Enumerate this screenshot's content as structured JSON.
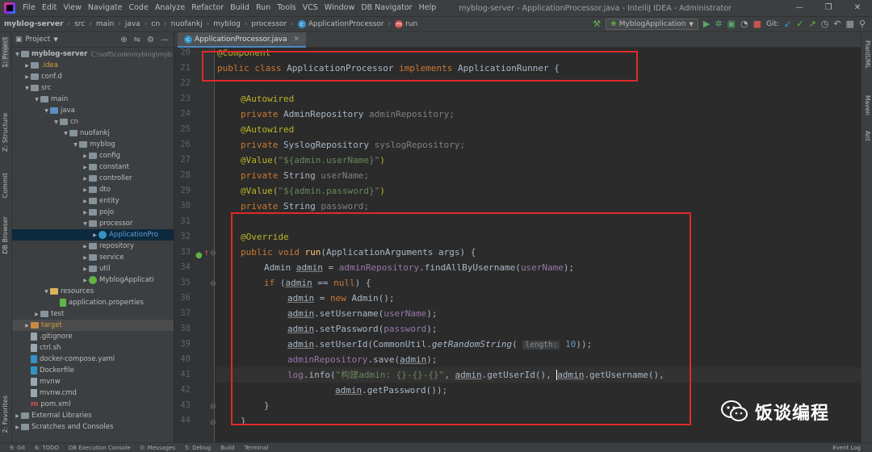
{
  "menubar": {
    "items": [
      "File",
      "Edit",
      "View",
      "Navigate",
      "Code",
      "Analyze",
      "Refactor",
      "Build",
      "Run",
      "Tools",
      "VCS",
      "Window",
      "DB Navigator",
      "Help"
    ],
    "window_title": "myblog-server - ApplicationProcessor.java - IntelliJ IDEA - Administrator",
    "minimize": "—",
    "maximize": "❐",
    "close": "✕"
  },
  "navbar": {
    "crumbs": [
      "myblog-server",
      "src",
      "main",
      "java",
      "cn",
      "nuofankj",
      "myblog",
      "processor",
      "ApplicationProcessor",
      "run"
    ],
    "run_config": "MyblogApplication",
    "git_label": "Git:"
  },
  "toolstrip_left": {
    "project": "1: Project",
    "structure": "Z: Structure",
    "commit": "Commit",
    "db_browser": "DB Browser",
    "favorites": "2: Favorites"
  },
  "toolstrip_right": {
    "plantuml": "PlantUML",
    "maven": "Maven",
    "ant": "Ant"
  },
  "project_panel": {
    "title": "Project",
    "root_name": "myblog-server",
    "root_path": "C:\\soft\\code\\myblog\\myb",
    "items": {
      "idea": ".idea",
      "conf": "conf.d",
      "src": "src",
      "main": "main",
      "java": "java",
      "cn": "cn",
      "nuofankj": "nuofankj",
      "myblog": "myblog",
      "config": "config",
      "constant": "constant",
      "controller": "controller",
      "dto": "dto",
      "entity": "entity",
      "pojo": "pojo",
      "processor": "processor",
      "app_processor": "ApplicationPro",
      "repository": "repository",
      "service": "service",
      "util": "util",
      "myblog_app": "MyblogApplicati",
      "resources": "resources",
      "app_props": "application.properties",
      "test": "test",
      "target": "target",
      "gitignore": ".gitignore",
      "ctrl": "ctrl.sh",
      "docker": "docker-compose.yaml",
      "dockerfile": "Dockerfile",
      "mvnw": "mvnw",
      "mvnw_cmd": "mvnw.cmd",
      "pom": "pom.xml",
      "ext_libs": "External Libraries",
      "scratches": "Scratches and Consoles"
    }
  },
  "editor": {
    "tab_label": "ApplicationProcessor.java",
    "line_numbers": [
      "20",
      "21",
      "22",
      "23",
      "24",
      "25",
      "26",
      "27",
      "28",
      "29",
      "30",
      "31",
      "32",
      "33",
      "34",
      "35",
      "36",
      "37",
      "38",
      "39",
      "40",
      "41",
      "42",
      "43",
      "44"
    ],
    "code": {
      "l20": "@Component",
      "l21_kw1": "public class ",
      "l21_name": "ApplicationProcessor ",
      "l21_kw2": "implements ",
      "l21_iface": "ApplicationRunner {",
      "l23": "@Autowired",
      "l24_kw": "private ",
      "l24_type": "AdminRepository ",
      "l24_field": "adminRepository;",
      "l25": "@Autowired",
      "l26_kw": "private ",
      "l26_type": "SyslogRepository ",
      "l26_field": "syslogRepository;",
      "l27_ann": "@Value(",
      "l27_str": "\"${admin.userName}\"",
      "l27_end": ")",
      "l28_kw": "private ",
      "l28_type": "String ",
      "l28_field": "userName;",
      "l29_ann": "@Value(",
      "l29_str": "\"${admin.password}\"",
      "l29_end": ")",
      "l30_kw": "private ",
      "l30_type": "String ",
      "l30_field": "password;",
      "l32": "@Override",
      "l33_kw": "public void ",
      "l33_name": "run",
      "l33_rest": "(ApplicationArguments args) {",
      "l34_type": "Admin ",
      "l34_var": "admin",
      "l34_eq": " = ",
      "l34_repo": "adminRepository",
      "l34_call": ".findAllByUsername(",
      "l34_arg": "userName",
      "l34_end": ");",
      "l35_kw": "if ",
      "l35_open": "(",
      "l35_var": "admin",
      "l35_op": " == ",
      "l35_null": "null",
      "l35_end": ") {",
      "l36_var": "admin",
      "l36_eq": " = ",
      "l36_new": "new ",
      "l36_rest": "Admin();",
      "l37_var": "admin",
      "l37_call": ".setUsername(",
      "l37_arg": "userName",
      "l37_end": ");",
      "l38_var": "admin",
      "l38_call": ".setPassword(",
      "l38_arg": "password",
      "l38_end": ");",
      "l39_var": "admin",
      "l39_call": ".setUserId(CommonUtil.",
      "l39_static": "getRandomString",
      "l39_open": "( ",
      "l39_hint": "length:",
      "l39_num": " 10",
      "l39_end": "));",
      "l40_repo": "adminRepository",
      "l40_call": ".save(",
      "l40_var": "admin",
      "l40_end": ");",
      "l41_log": "log",
      "l41_call": ".info(",
      "l41_str": "\"构建admin: {}-{}-{}\"",
      "l41_comma": ", ",
      "l41_v1": "admin",
      "l41_c1": ".getUserId(), ",
      "l41_v2": "admin",
      "l41_c2": ".getUsername(),",
      "l42_v": "admin",
      "l42_c": ".getPassword());",
      "l43": "}",
      "l44": "}"
    }
  },
  "statusbar": {
    "items": [
      "9: Git",
      "6: TODO",
      "DB Execution Console",
      "0: Messages",
      "5: Debug",
      "Build",
      "Terminal"
    ],
    "event_log": "Event Log"
  },
  "watermark": {
    "text": "饭谈编程"
  }
}
